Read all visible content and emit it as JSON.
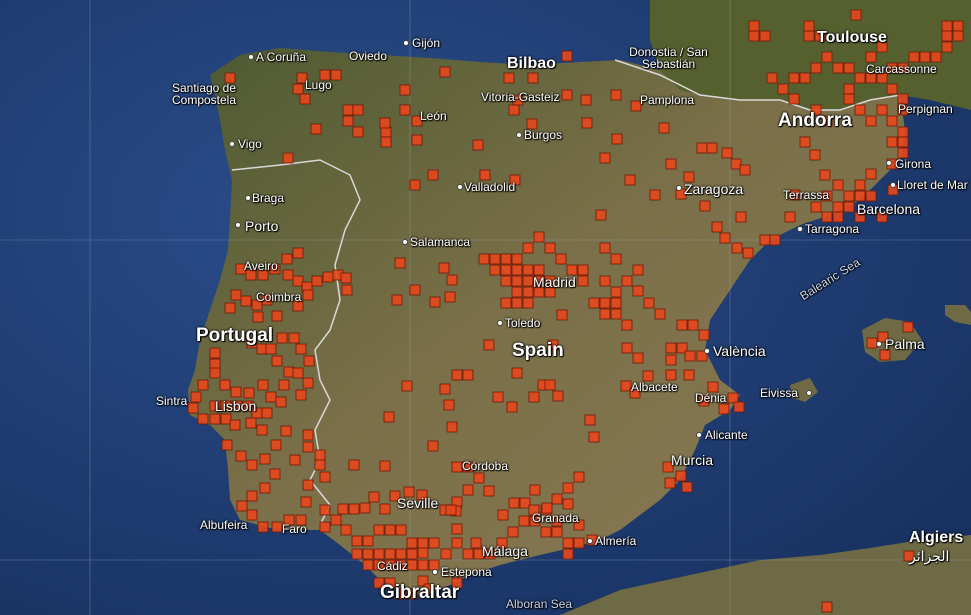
{
  "map": {
    "colors": {
      "sea": "#203f7a",
      "sea_deep": "#16305f",
      "land": "#6b6a44",
      "land_light": "#8a7b52",
      "land_green": "#4f5e32",
      "cell_fill": "#e8471c",
      "cell_border": "#6b1a08",
      "border_line": "#d8d8d8",
      "grid_line": "#9fb0d0"
    },
    "icons": [
      "city-dot-icon"
    ],
    "countries": [
      "Portugal",
      "Spain",
      "Andorra",
      "Gibraltar"
    ],
    "cities": [
      "A Coruña",
      "Oviedo",
      "Gijón",
      "Santiago de Compostela",
      "Lugo",
      "Bilbao",
      "Donostia / San Sebastián",
      "Toulouse",
      "Carcassonne",
      "Vitoria-Gasteiz",
      "Pamplona",
      "León",
      "Burgos",
      "Vigo",
      "Perpignan",
      "Braga",
      "Girona",
      "Valladolid",
      "Zaragoza",
      "Lloret de Mar",
      "Terrassa",
      "Porto",
      "Barcelona",
      "Tarragona",
      "Salamanca",
      "Aveiro",
      "Madrid",
      "Coimbra",
      "Toledo",
      "Palma",
      "València",
      "Albacete",
      "Sintra",
      "Lisbon",
      "Eivissa",
      "Dénia",
      "Alicante",
      "Córdoba",
      "Murcia",
      "Seville",
      "Albufeira",
      "Faro",
      "Granada",
      "Almería",
      "Málaga",
      "Algiers",
      "الجزائر",
      "Cádiz",
      "Estepona",
      "Gibraltar",
      "Alboran Sea",
      "Balearic Sea"
    ],
    "observation_cells": [
      [
        225,
        73
      ],
      [
        297,
        73
      ],
      [
        320,
        70
      ],
      [
        331,
        70
      ],
      [
        562,
        51
      ],
      [
        749,
        21
      ],
      [
        760,
        31
      ],
      [
        749,
        31
      ],
      [
        804,
        21
      ],
      [
        815,
        31
      ],
      [
        804,
        31
      ],
      [
        851,
        10
      ],
      [
        942,
        21
      ],
      [
        953,
        21
      ],
      [
        942,
        31
      ],
      [
        953,
        31
      ],
      [
        942,
        42
      ],
      [
        931,
        52
      ],
      [
        920,
        52
      ],
      [
        909,
        52
      ],
      [
        898,
        63
      ],
      [
        887,
        63
      ],
      [
        877,
        73
      ],
      [
        866,
        73
      ],
      [
        855,
        73
      ],
      [
        844,
        63
      ],
      [
        833,
        63
      ],
      [
        822,
        52
      ],
      [
        811,
        63
      ],
      [
        800,
        73
      ],
      [
        789,
        73
      ],
      [
        866,
        52
      ],
      [
        877,
        42
      ],
      [
        844,
        84
      ],
      [
        844,
        94
      ],
      [
        855,
        105
      ],
      [
        866,
        116
      ],
      [
        877,
        105
      ],
      [
        887,
        84
      ],
      [
        898,
        94
      ],
      [
        898,
        105
      ],
      [
        887,
        116
      ],
      [
        898,
        127
      ],
      [
        898,
        137
      ],
      [
        887,
        137
      ],
      [
        898,
        148
      ],
      [
        887,
        159
      ],
      [
        866,
        169
      ],
      [
        855,
        180
      ],
      [
        844,
        191
      ],
      [
        833,
        202
      ],
      [
        822,
        212
      ],
      [
        811,
        202
      ],
      [
        822,
        191
      ],
      [
        833,
        180
      ],
      [
        855,
        191
      ],
      [
        866,
        191
      ],
      [
        833,
        212
      ],
      [
        844,
        202
      ],
      [
        855,
        212
      ],
      [
        877,
        212
      ],
      [
        888,
        185
      ],
      [
        800,
        137
      ],
      [
        822,
        116
      ],
      [
        811,
        105
      ],
      [
        789,
        94
      ],
      [
        778,
        84
      ],
      [
        767,
        73
      ],
      [
        293,
        84
      ],
      [
        300,
        94
      ],
      [
        343,
        105
      ],
      [
        353,
        105
      ],
      [
        343,
        116
      ],
      [
        353,
        127
      ],
      [
        381,
        127
      ],
      [
        381,
        137
      ],
      [
        400,
        105
      ],
      [
        412,
        116
      ],
      [
        380,
        118
      ],
      [
        412,
        135
      ],
      [
        440,
        67
      ],
      [
        400,
        85
      ],
      [
        311,
        124
      ],
      [
        283,
        153
      ],
      [
        504,
        73
      ],
      [
        528,
        73
      ],
      [
        513,
        95
      ],
      [
        473,
        140
      ],
      [
        480,
        170
      ],
      [
        410,
        180
      ],
      [
        428,
        170
      ],
      [
        509,
        105
      ],
      [
        527,
        119
      ],
      [
        562,
        90
      ],
      [
        581,
        95
      ],
      [
        611,
        90
      ],
      [
        631,
        101
      ],
      [
        659,
        123
      ],
      [
        612,
        134
      ],
      [
        582,
        118
      ],
      [
        600,
        153
      ],
      [
        684,
        172
      ],
      [
        697,
        143
      ],
      [
        707,
        143
      ],
      [
        722,
        148
      ],
      [
        731,
        159
      ],
      [
        740,
        165
      ],
      [
        666,
        159
      ],
      [
        676,
        189
      ],
      [
        700,
        201
      ],
      [
        712,
        222
      ],
      [
        736,
        212
      ],
      [
        743,
        248
      ],
      [
        732,
        243
      ],
      [
        720,
        233
      ],
      [
        760,
        235
      ],
      [
        770,
        235
      ],
      [
        785,
        212
      ],
      [
        790,
        190
      ],
      [
        820,
        170
      ],
      [
        810,
        150
      ],
      [
        625,
        175
      ],
      [
        650,
        190
      ],
      [
        596,
        210
      ],
      [
        510,
        175
      ],
      [
        236,
        264
      ],
      [
        246,
        270
      ],
      [
        258,
        270
      ],
      [
        270,
        264
      ],
      [
        282,
        254
      ],
      [
        293,
        248
      ],
      [
        283,
        270
      ],
      [
        293,
        276
      ],
      [
        302,
        282
      ],
      [
        312,
        276
      ],
      [
        323,
        272
      ],
      [
        333,
        270
      ],
      [
        303,
        290
      ],
      [
        293,
        301
      ],
      [
        262,
        295
      ],
      [
        252,
        300
      ],
      [
        272,
        311
      ],
      [
        253,
        312
      ],
      [
        241,
        296
      ],
      [
        231,
        290
      ],
      [
        225,
        303
      ],
      [
        247,
        338
      ],
      [
        257,
        344
      ],
      [
        266,
        344
      ],
      [
        277,
        333
      ],
      [
        289,
        333
      ],
      [
        296,
        344
      ],
      [
        272,
        356
      ],
      [
        284,
        367
      ],
      [
        293,
        368
      ],
      [
        304,
        356
      ],
      [
        303,
        378
      ],
      [
        296,
        390
      ],
      [
        279,
        380
      ],
      [
        266,
        392
      ],
      [
        258,
        380
      ],
      [
        244,
        388
      ],
      [
        231,
        387
      ],
      [
        220,
        380
      ],
      [
        210,
        348
      ],
      [
        210,
        359
      ],
      [
        210,
        368
      ],
      [
        198,
        380
      ],
      [
        191,
        392
      ],
      [
        188,
        403
      ],
      [
        198,
        414
      ],
      [
        210,
        414
      ],
      [
        221,
        414
      ],
      [
        210,
        401
      ],
      [
        221,
        401
      ],
      [
        232,
        401
      ],
      [
        243,
        401
      ],
      [
        252,
        408
      ],
      [
        262,
        408
      ],
      [
        246,
        418
      ],
      [
        257,
        425
      ],
      [
        230,
        420
      ],
      [
        222,
        440
      ],
      [
        236,
        451
      ],
      [
        247,
        460
      ],
      [
        260,
        454
      ],
      [
        271,
        440
      ],
      [
        281,
        426
      ],
      [
        303,
        430
      ],
      [
        303,
        442
      ],
      [
        315,
        450
      ],
      [
        315,
        460
      ],
      [
        320,
        472
      ],
      [
        303,
        480
      ],
      [
        290,
        455
      ],
      [
        270,
        469
      ],
      [
        260,
        483
      ],
      [
        247,
        491
      ],
      [
        237,
        501
      ],
      [
        247,
        510
      ],
      [
        258,
        522
      ],
      [
        272,
        522
      ],
      [
        284,
        515
      ],
      [
        296,
        515
      ],
      [
        301,
        497
      ],
      [
        320,
        505
      ],
      [
        320,
        522
      ],
      [
        276,
        397
      ],
      [
        341,
        273
      ],
      [
        342,
        285
      ],
      [
        395,
        258
      ],
      [
        439,
        263
      ],
      [
        447,
        275
      ],
      [
        445,
        292
      ],
      [
        430,
        297
      ],
      [
        410,
        285
      ],
      [
        392,
        295
      ],
      [
        402,
        381
      ],
      [
        384,
        412
      ],
      [
        349,
        460
      ],
      [
        380,
        461
      ],
      [
        479,
        254
      ],
      [
        490,
        254
      ],
      [
        501,
        254
      ],
      [
        512,
        254
      ],
      [
        490,
        265
      ],
      [
        501,
        265
      ],
      [
        512,
        265
      ],
      [
        523,
        265
      ],
      [
        534,
        265
      ],
      [
        501,
        276
      ],
      [
        512,
        276
      ],
      [
        523,
        276
      ],
      [
        534,
        276
      ],
      [
        545,
        276
      ],
      [
        512,
        287
      ],
      [
        523,
        287
      ],
      [
        534,
        287
      ],
      [
        545,
        287
      ],
      [
        501,
        298
      ],
      [
        512,
        298
      ],
      [
        523,
        298
      ],
      [
        523,
        243
      ],
      [
        534,
        232
      ],
      [
        545,
        243
      ],
      [
        556,
        254
      ],
      [
        567,
        265
      ],
      [
        578,
        265
      ],
      [
        578,
        276
      ],
      [
        589,
        298
      ],
      [
        600,
        298
      ],
      [
        611,
        298
      ],
      [
        600,
        309
      ],
      [
        611,
        309
      ],
      [
        622,
        320
      ],
      [
        600,
        276
      ],
      [
        611,
        287
      ],
      [
        622,
        276
      ],
      [
        633,
        265
      ],
      [
        611,
        254
      ],
      [
        600,
        243
      ],
      [
        633,
        286
      ],
      [
        644,
        298
      ],
      [
        655,
        309
      ],
      [
        622,
        343
      ],
      [
        633,
        353
      ],
      [
        666,
        343
      ],
      [
        677,
        343
      ],
      [
        677,
        320
      ],
      [
        688,
        320
      ],
      [
        699,
        330
      ],
      [
        697,
        351
      ],
      [
        685,
        351
      ],
      [
        666,
        355
      ],
      [
        484,
        340
      ],
      [
        557,
        310
      ],
      [
        548,
        340
      ],
      [
        512,
        368
      ],
      [
        538,
        380
      ],
      [
        545,
        380
      ],
      [
        621,
        381
      ],
      [
        630,
        388
      ],
      [
        643,
        371
      ],
      [
        666,
        370
      ],
      [
        684,
        370
      ],
      [
        708,
        382
      ],
      [
        699,
        396
      ],
      [
        719,
        404
      ],
      [
        728,
        393
      ],
      [
        734,
        402
      ],
      [
        585,
        415
      ],
      [
        589,
        432
      ],
      [
        553,
        391
      ],
      [
        529,
        392
      ],
      [
        493,
        392
      ],
      [
        507,
        402
      ],
      [
        463,
        370
      ],
      [
        452,
        370
      ],
      [
        440,
        384
      ],
      [
        444,
        400
      ],
      [
        447,
        422
      ],
      [
        428,
        441
      ],
      [
        452,
        462
      ],
      [
        463,
        462
      ],
      [
        474,
        473
      ],
      [
        484,
        486
      ],
      [
        463,
        485
      ],
      [
        452,
        497
      ],
      [
        440,
        505
      ],
      [
        417,
        490
      ],
      [
        404,
        487
      ],
      [
        390,
        491
      ],
      [
        380,
        504
      ],
      [
        369,
        492
      ],
      [
        360,
        503
      ],
      [
        349,
        504
      ],
      [
        338,
        504
      ],
      [
        331,
        515
      ],
      [
        341,
        525
      ],
      [
        352,
        536
      ],
      [
        363,
        536
      ],
      [
        374,
        525
      ],
      [
        385,
        525
      ],
      [
        396,
        525
      ],
      [
        407,
        538
      ],
      [
        418,
        548
      ],
      [
        429,
        560
      ],
      [
        418,
        560
      ],
      [
        407,
        560
      ],
      [
        396,
        560
      ],
      [
        385,
        560
      ],
      [
        374,
        560
      ],
      [
        363,
        560
      ],
      [
        352,
        549
      ],
      [
        363,
        549
      ],
      [
        374,
        549
      ],
      [
        385,
        549
      ],
      [
        396,
        549
      ],
      [
        407,
        549
      ],
      [
        418,
        538
      ],
      [
        429,
        538
      ],
      [
        441,
        549
      ],
      [
        452,
        538
      ],
      [
        463,
        549
      ],
      [
        474,
        549
      ],
      [
        485,
        549
      ],
      [
        497,
        538
      ],
      [
        508,
        527
      ],
      [
        519,
        516
      ],
      [
        530,
        516
      ],
      [
        541,
        527
      ],
      [
        552,
        527
      ],
      [
        563,
        538
      ],
      [
        574,
        538
      ],
      [
        563,
        549
      ],
      [
        552,
        516
      ],
      [
        541,
        505
      ],
      [
        552,
        494
      ],
      [
        563,
        483
      ],
      [
        574,
        472
      ],
      [
        563,
        499
      ],
      [
        574,
        520
      ],
      [
        498,
        510
      ],
      [
        509,
        498
      ],
      [
        520,
        498
      ],
      [
        530,
        485
      ],
      [
        451,
        506
      ],
      [
        452,
        524
      ],
      [
        471,
        538
      ],
      [
        446,
        505
      ],
      [
        374,
        578
      ],
      [
        385,
        578
      ],
      [
        396,
        589
      ],
      [
        407,
        589
      ],
      [
        418,
        576
      ],
      [
        452,
        578
      ],
      [
        424,
        584
      ],
      [
        542,
        503
      ],
      [
        529,
        505
      ],
      [
        663,
        462
      ],
      [
        676,
        471
      ],
      [
        682,
        482
      ],
      [
        665,
        478
      ],
      [
        587,
        535
      ],
      [
        867,
        338
      ],
      [
        878,
        332
      ],
      [
        903,
        322
      ],
      [
        880,
        350
      ],
      [
        904,
        551
      ],
      [
        822,
        602
      ]
    ],
    "label_positions_note": "labels drawn in markup"
  }
}
